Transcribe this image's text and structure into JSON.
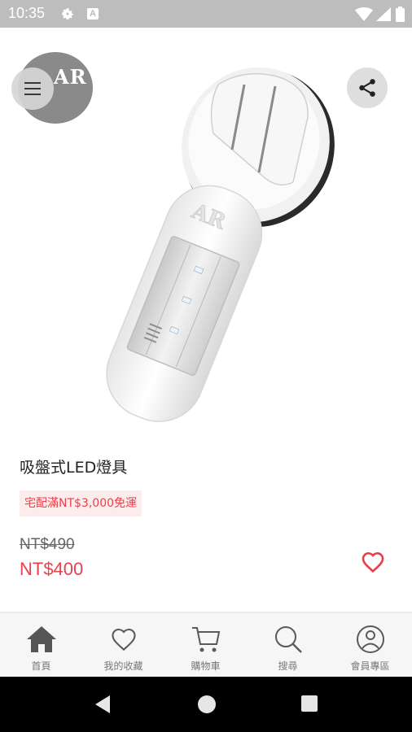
{
  "status_bar": {
    "time": "10:35",
    "icons": [
      "settings-gear-icon",
      "accessibility-a-icon",
      "wifi-icon",
      "signal-icon",
      "battery-icon"
    ],
    "a_label": "A"
  },
  "header": {
    "logo_text": "AR",
    "menu_icon": "hamburger-menu-icon",
    "share_icon": "share-icon"
  },
  "product": {
    "title": "吸盤式LED燈具",
    "shipping_badge": "宅配滿NT$3,000免運",
    "original_price": "NT$490",
    "sale_price": "NT$400",
    "favorite_icon": "heart-outline-icon",
    "lamp_logo_text": "AR"
  },
  "bottom_nav": {
    "items": [
      {
        "label": "首頁",
        "icon": "home-icon",
        "active": true
      },
      {
        "label": "我的收藏",
        "icon": "heart-icon"
      },
      {
        "label": "購物車",
        "icon": "cart-icon"
      },
      {
        "label": "搜尋",
        "icon": "search-icon"
      },
      {
        "label": "會員專區",
        "icon": "user-icon"
      }
    ]
  },
  "android_nav": {
    "icons": [
      "back-icon",
      "home-circle-icon",
      "recents-square-icon"
    ]
  },
  "colors": {
    "accent_red": "#e8414e",
    "badge_background": "#fdecec",
    "status_bar": "#bdbdbd",
    "nav_background": "#f6f6f6",
    "nav_icon": "#5a5a5a"
  }
}
